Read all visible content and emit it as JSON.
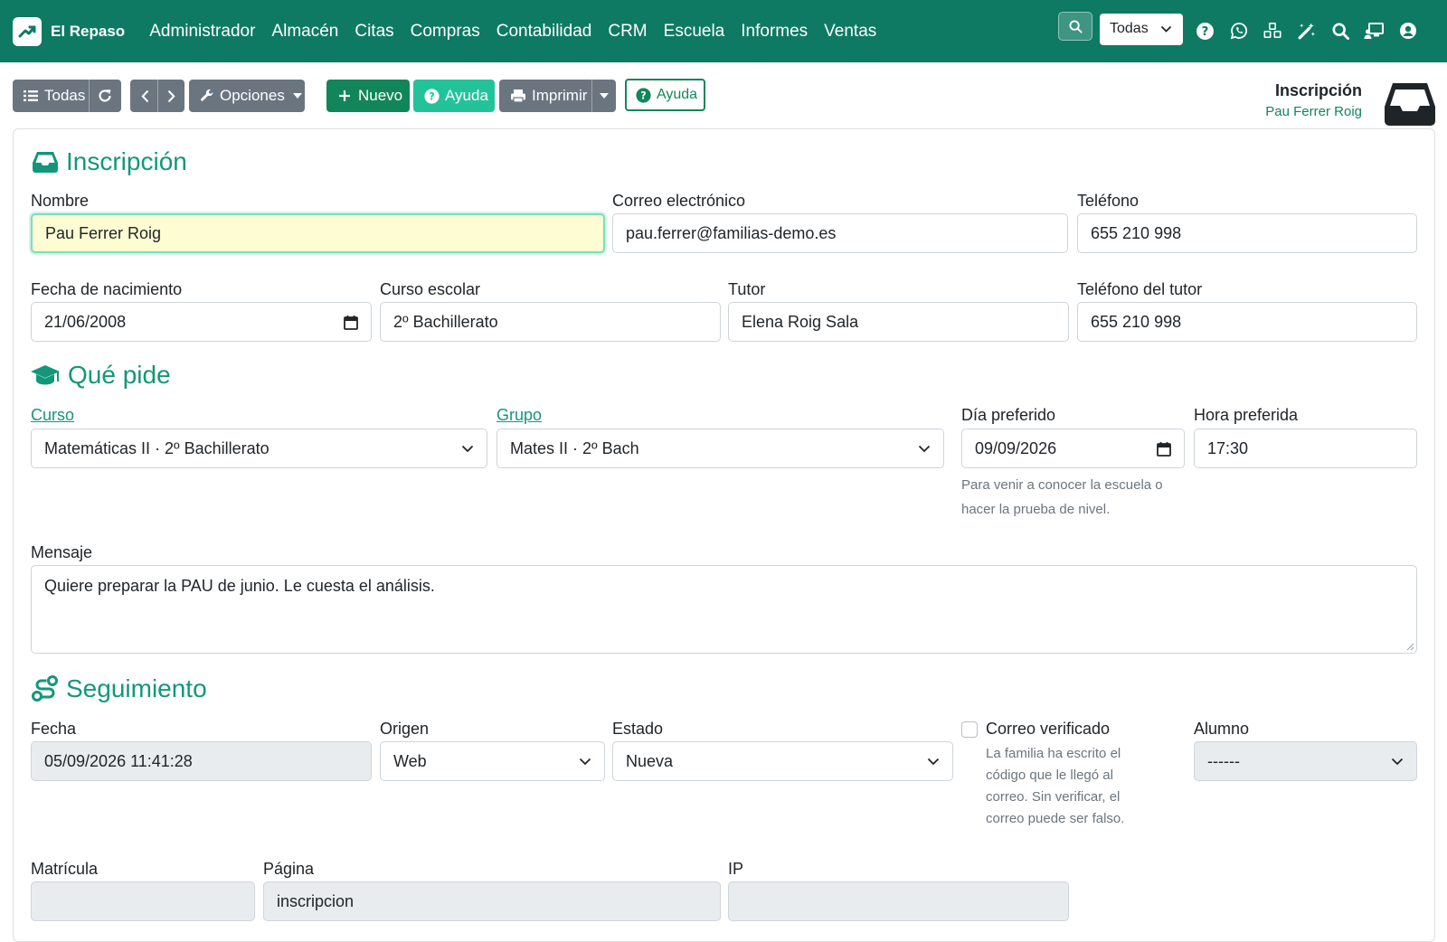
{
  "app": {
    "name": "El Repaso"
  },
  "nav": {
    "items": [
      "Administrador",
      "Almacén",
      "Citas",
      "Compras",
      "Contabilidad",
      "CRM",
      "Escuela",
      "Informes",
      "Ventas"
    ],
    "company_select": "Todas",
    "icons": [
      "help-circle-icon",
      "whatsapp-icon",
      "cubes-icon",
      "magic-wand-icon",
      "search-icon",
      "chalkboard-user-icon",
      "user-circle-icon"
    ]
  },
  "toolbar": {
    "all_label": "Todas",
    "options_label": "Opciones",
    "new_label": "Nuevo",
    "help_label": "Ayuda",
    "print_label": "Imprimir",
    "help_outline_label": "Ayuda"
  },
  "header": {
    "title": "Inscripción",
    "subtitle": "Pau Ferrer Roig"
  },
  "sections": {
    "inscripcion": "Inscripción",
    "que_pide": "Qué pide",
    "seguimiento": "Seguimiento"
  },
  "form": {
    "nombre": {
      "label": "Nombre",
      "value": "Pau Ferrer Roig"
    },
    "correo": {
      "label": "Correo electrónico",
      "value": "pau.ferrer@familias-demo.es"
    },
    "telefono": {
      "label": "Teléfono",
      "value": "655 210 998"
    },
    "fecha_nacimiento": {
      "label": "Fecha de nacimiento",
      "value": "21/06/2008"
    },
    "curso_escolar": {
      "label": "Curso escolar",
      "value": "2º Bachillerato"
    },
    "tutor": {
      "label": "Tutor",
      "value": "Elena Roig Sala"
    },
    "telefono_tutor": {
      "label": "Teléfono del tutor",
      "value": "655 210 998"
    },
    "curso": {
      "label": "Curso",
      "value": "Matemáticas II · 2º Bachillerato"
    },
    "grupo": {
      "label": "Grupo",
      "value": "Mates II · 2º Bach"
    },
    "dia_preferido": {
      "label": "Día preferido",
      "value": "09/09/2026",
      "help_line1": "Para venir a conocer la escuela o",
      "help_line2": "hacer la prueba de nivel."
    },
    "hora_preferida": {
      "label": "Hora preferida",
      "value": "17:30"
    },
    "mensaje": {
      "label": "Mensaje",
      "value": "Quiere preparar la PAU de junio. Le cuesta el análisis."
    },
    "fecha": {
      "label": "Fecha",
      "value": "05/09/2026 11:41:28"
    },
    "origen": {
      "label": "Origen",
      "value": "Web"
    },
    "estado": {
      "label": "Estado",
      "value": "Nueva"
    },
    "correo_verificado": {
      "label": "Correo verificado",
      "checked": false,
      "help_line1": "La familia ha escrito el",
      "help_line2": "código que le llegó al",
      "help_line3": "correo. Sin verificar, el",
      "help_line4": "correo puede ser falso."
    },
    "alumno": {
      "label": "Alumno",
      "value": "------"
    },
    "matricula": {
      "label": "Matrícula",
      "value": ""
    },
    "pagina": {
      "label": "Página",
      "value": "inscripcion"
    },
    "ip": {
      "label": "IP",
      "value": ""
    }
  },
  "colors": {
    "navbar": "#0e7a63",
    "accent": "#13977a",
    "primary_button": "#12865a",
    "help_button": "#22c39b",
    "gray_button": "#6b7580"
  }
}
